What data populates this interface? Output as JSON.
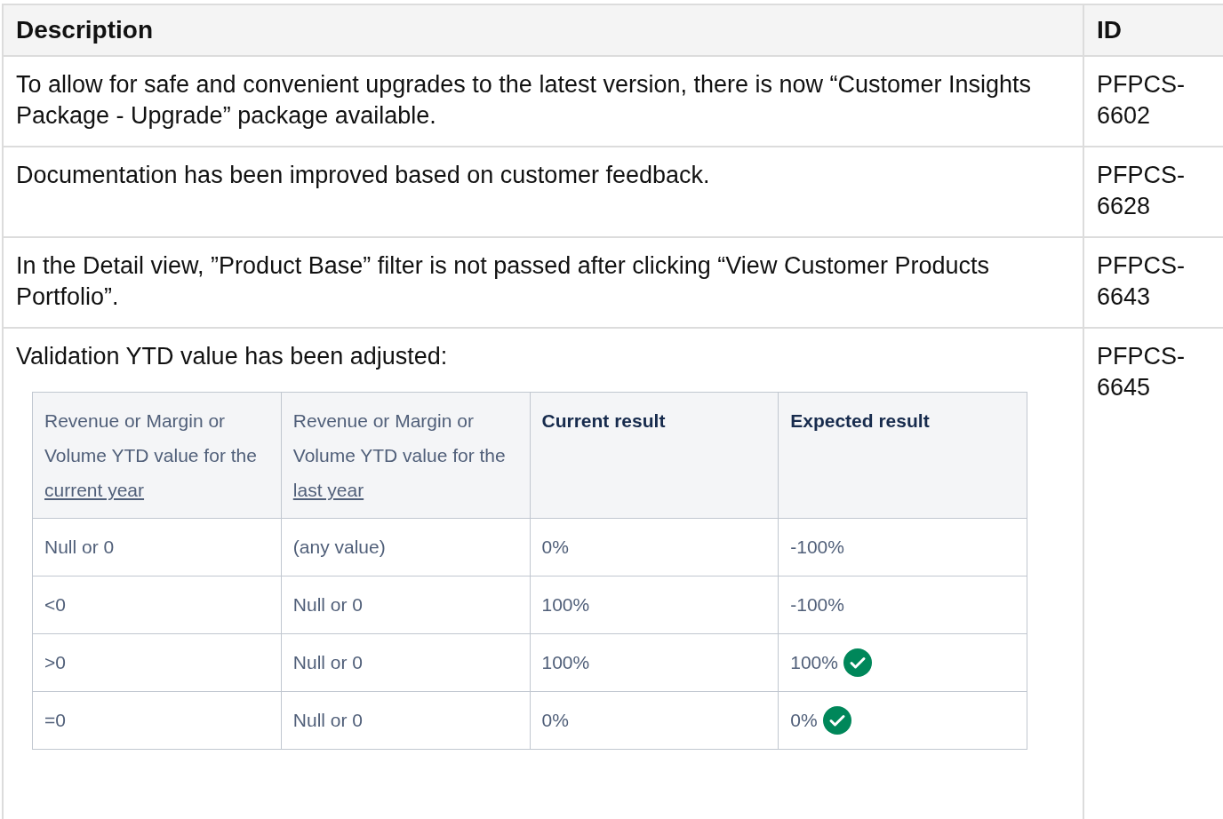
{
  "table": {
    "columns": [
      "Description",
      "ID"
    ],
    "rows": [
      {
        "description": "To allow for safe and convenient upgrades to the latest version, there is now “Customer Insights Package - Upgrade” package available.",
        "id": "PFPCS-6602"
      },
      {
        "description": "Documentation has been improved based on customer feedback.",
        "id": "PFPCS-6628"
      },
      {
        "description": "In the Detail view, ”Product Base” filter is not passed after clicking “View Customer Products Portfolio”.",
        "id": "PFPCS-6643"
      },
      {
        "description": "Validation YTD value has been adjusted:",
        "id": "PFPCS-6645",
        "nested_table": {
          "columns": [
            {
              "text": "Revenue or Margin or Volume YTD value for the",
              "link": "current year",
              "bold": false
            },
            {
              "text": "Revenue or Margin or Volume YTD value for the",
              "link": "last year",
              "bold": false
            },
            {
              "text": "Current result",
              "bold": true
            },
            {
              "text": "Expected result",
              "bold": true
            }
          ],
          "rows": [
            {
              "cells": [
                "Null or 0",
                "(any value)",
                "0%",
                "-100%"
              ],
              "approved": false
            },
            {
              "cells": [
                "<0",
                "Null or 0",
                "100%",
                "-100%"
              ],
              "approved": false
            },
            {
              "cells": [
                ">0",
                "Null or 0",
                "100%",
                "100%"
              ],
              "approved": true
            },
            {
              "cells": [
                "=0",
                "Null or 0",
                "0%",
                "0%"
              ],
              "approved": true
            }
          ]
        }
      }
    ]
  }
}
